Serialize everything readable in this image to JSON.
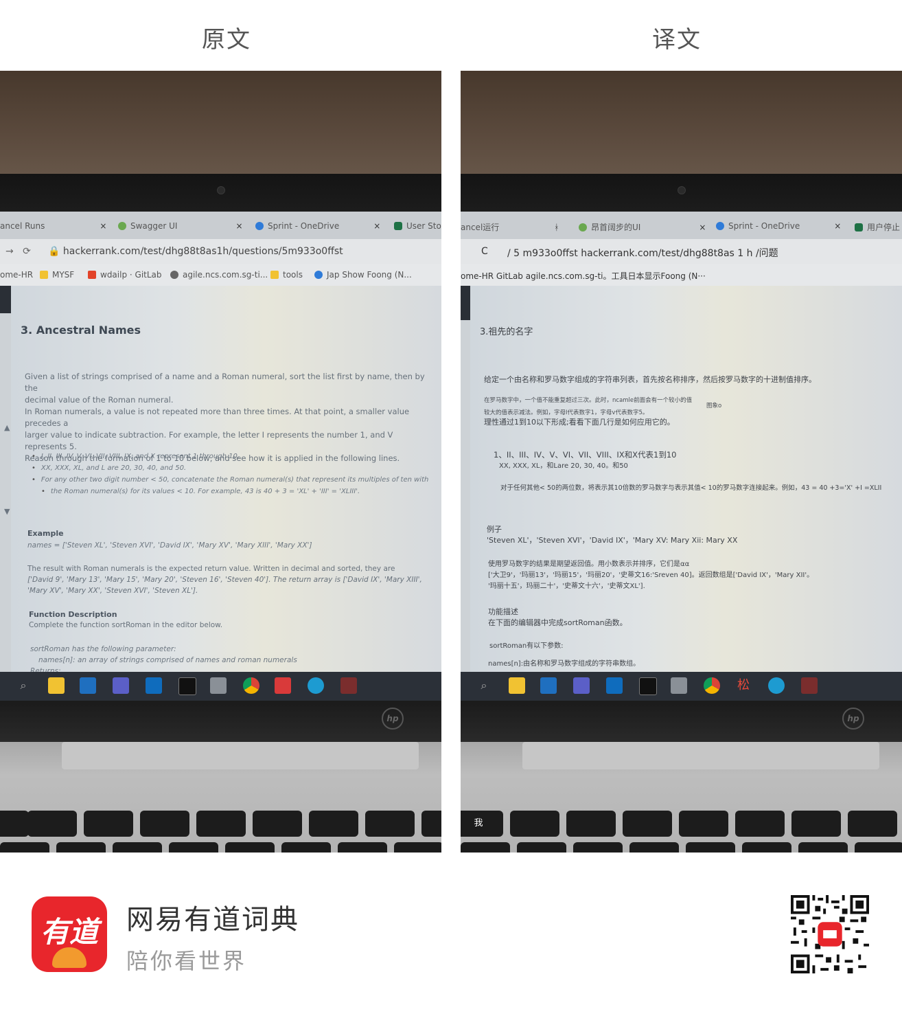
{
  "headers": {
    "left": "原文",
    "right": "译文"
  },
  "original": {
    "tabs": [
      {
        "label": "ancel Runs",
        "close": "×"
      },
      {
        "label": "Swagger UI",
        "close": "×"
      },
      {
        "label": "Sprint - OneDrive",
        "close": "×"
      },
      {
        "label": "User Stor",
        "close": ""
      }
    ],
    "url": "hackerrank.com/test/dhg88t8as1h/questions/5m933o0ffst",
    "bookmarks": [
      "ome-HR",
      "MYSF",
      "wdailp · GitLab",
      "agile.ncs.com.sg-ti...",
      "tools",
      "Jap Show Foong (N..."
    ],
    "heading": "3. Ancestral Names",
    "intro": [
      "Given a list of strings comprised of a name and a Roman numeral, sort the list first by name, then by the",
      "decimal value of the Roman numeral.",
      "In Roman numerals, a value is not repeated more than three times. At that point, a smaller value precedes a",
      "larger value to indicate subtraction. For example, the letter I represents the number 1, and V represents 5.",
      "Reason through the formation of 1 to 10 below, and see how it is applied in the following lines."
    ],
    "bullets": [
      "I, II, III, IV, V, VI, VII, VIII, IX, and X represent 1 through 10.",
      "XX, XXX, XL, and L are 20, 30, 40, and 50.",
      "For any other two digit number < 50, concatenate the Roman numeral(s) that represent its multiples of ten with",
      "the Roman numeral(s) for its values < 10. For example, 43 is 40 + 3 = 'XL' + 'III' = 'XLIII'."
    ],
    "example_label": "Example",
    "example_names": "names = ['Steven XL', 'Steven XVI', 'David IX', 'Mary XV', 'Mary XIII', 'Mary XX']",
    "result": [
      "The result with Roman numerals is the expected return value. Written in decimal and sorted, they are",
      "['David 9', 'Mary 13', 'Mary 15', 'Mary 20', 'Steven 16', 'Steven 40']. The return array is ['David IX', 'Mary XIII',",
      "'Mary XV', 'Mary XX', 'Steven XVI', 'Steven XL']."
    ],
    "func_label": "Function Description",
    "func_desc": "Complete the function sortRoman in the editor below.",
    "param_line": "sortRoman has the following parameter:",
    "param_names": "names[n]:  an array of strings comprised of names and roman numerals",
    "returns": "Returns:"
  },
  "translated": {
    "tabs": [
      {
        "label": "ancel运行",
        "close": ""
      },
      {
        "label": "昂首阔步的UI",
        "close": "×"
      },
      {
        "label": "Sprint - OneDrive",
        "close": "×"
      },
      {
        "label": "用户停止",
        "close": ""
      }
    ],
    "nav": "C",
    "url": "/ 5 m933o0ffst hackerrank.com/test/dhg88t8as 1 h /问题",
    "bookmarks": "ome-HR GitLab agile.ncs.com.sg-ti。工具日本显示Foong (N···",
    "heading": "3.祖先的名字",
    "intro": "给定一个由名称和罗马数字组成的字符串列表，首先按名称排序，然后按罗马数字的十进制值排序。",
    "small1": "在罗马数字中，一个值不能重复超过三次。此时，ncamle前面会有一个较小的值",
    "small_side": "图象o",
    "small2": "较大的值表示减法。例如，字母I代表数字1，字母v代表数字5。",
    "reason": "理性通过1到10以下形成;看看下面几行是如何应用它的。",
    "bullet1": "1、II、III、IV、V、VI、VII、VIII、IX和X代表1到10",
    "bullet2": "XX, XXX, XL，和Lare 20, 30, 40。和50",
    "bullet3": "对于任何其他< 50的两位数，将表示其10倍数的罗马数字与表示其值< 10的罗马数字连接起来。例如，43 = 40 +3='X' +I =XLII",
    "example_label": "例子",
    "example_names": "'Steven XL'，'Steven XVI'，'David IX'，'Mary XV: Mary Xii: Mary XX",
    "result1": "使用罗马数字的结果是期望返回值。用小数表示并排序，它们是αα",
    "result2": "['大卫9'，'玛丽13'，'玛丽15'，'玛丽20'，'史蒂文16:'Sreven 40]。返回数组是['David IX'，'Mary XII'。",
    "result3": "'玛丽十五'，玛丽二十'，'史蒂文十六'，'史蒂文XL'].",
    "func_label": "功能描述",
    "func_desc": "在下面的编辑器中完成sortRoman函数。",
    "param_line": "sortRoman有以下参数:",
    "param_names": "names[n]:由名称和罗马数字组成的字符串数组。",
    "taskbar_char": "松",
    "key_char": "我"
  },
  "footer": {
    "logo_text": "有道",
    "app_name": "网易有道词典",
    "slogan": "陪你看世界"
  },
  "colors": {
    "brand": "#e8262c",
    "taskbar": "#2b3038"
  }
}
